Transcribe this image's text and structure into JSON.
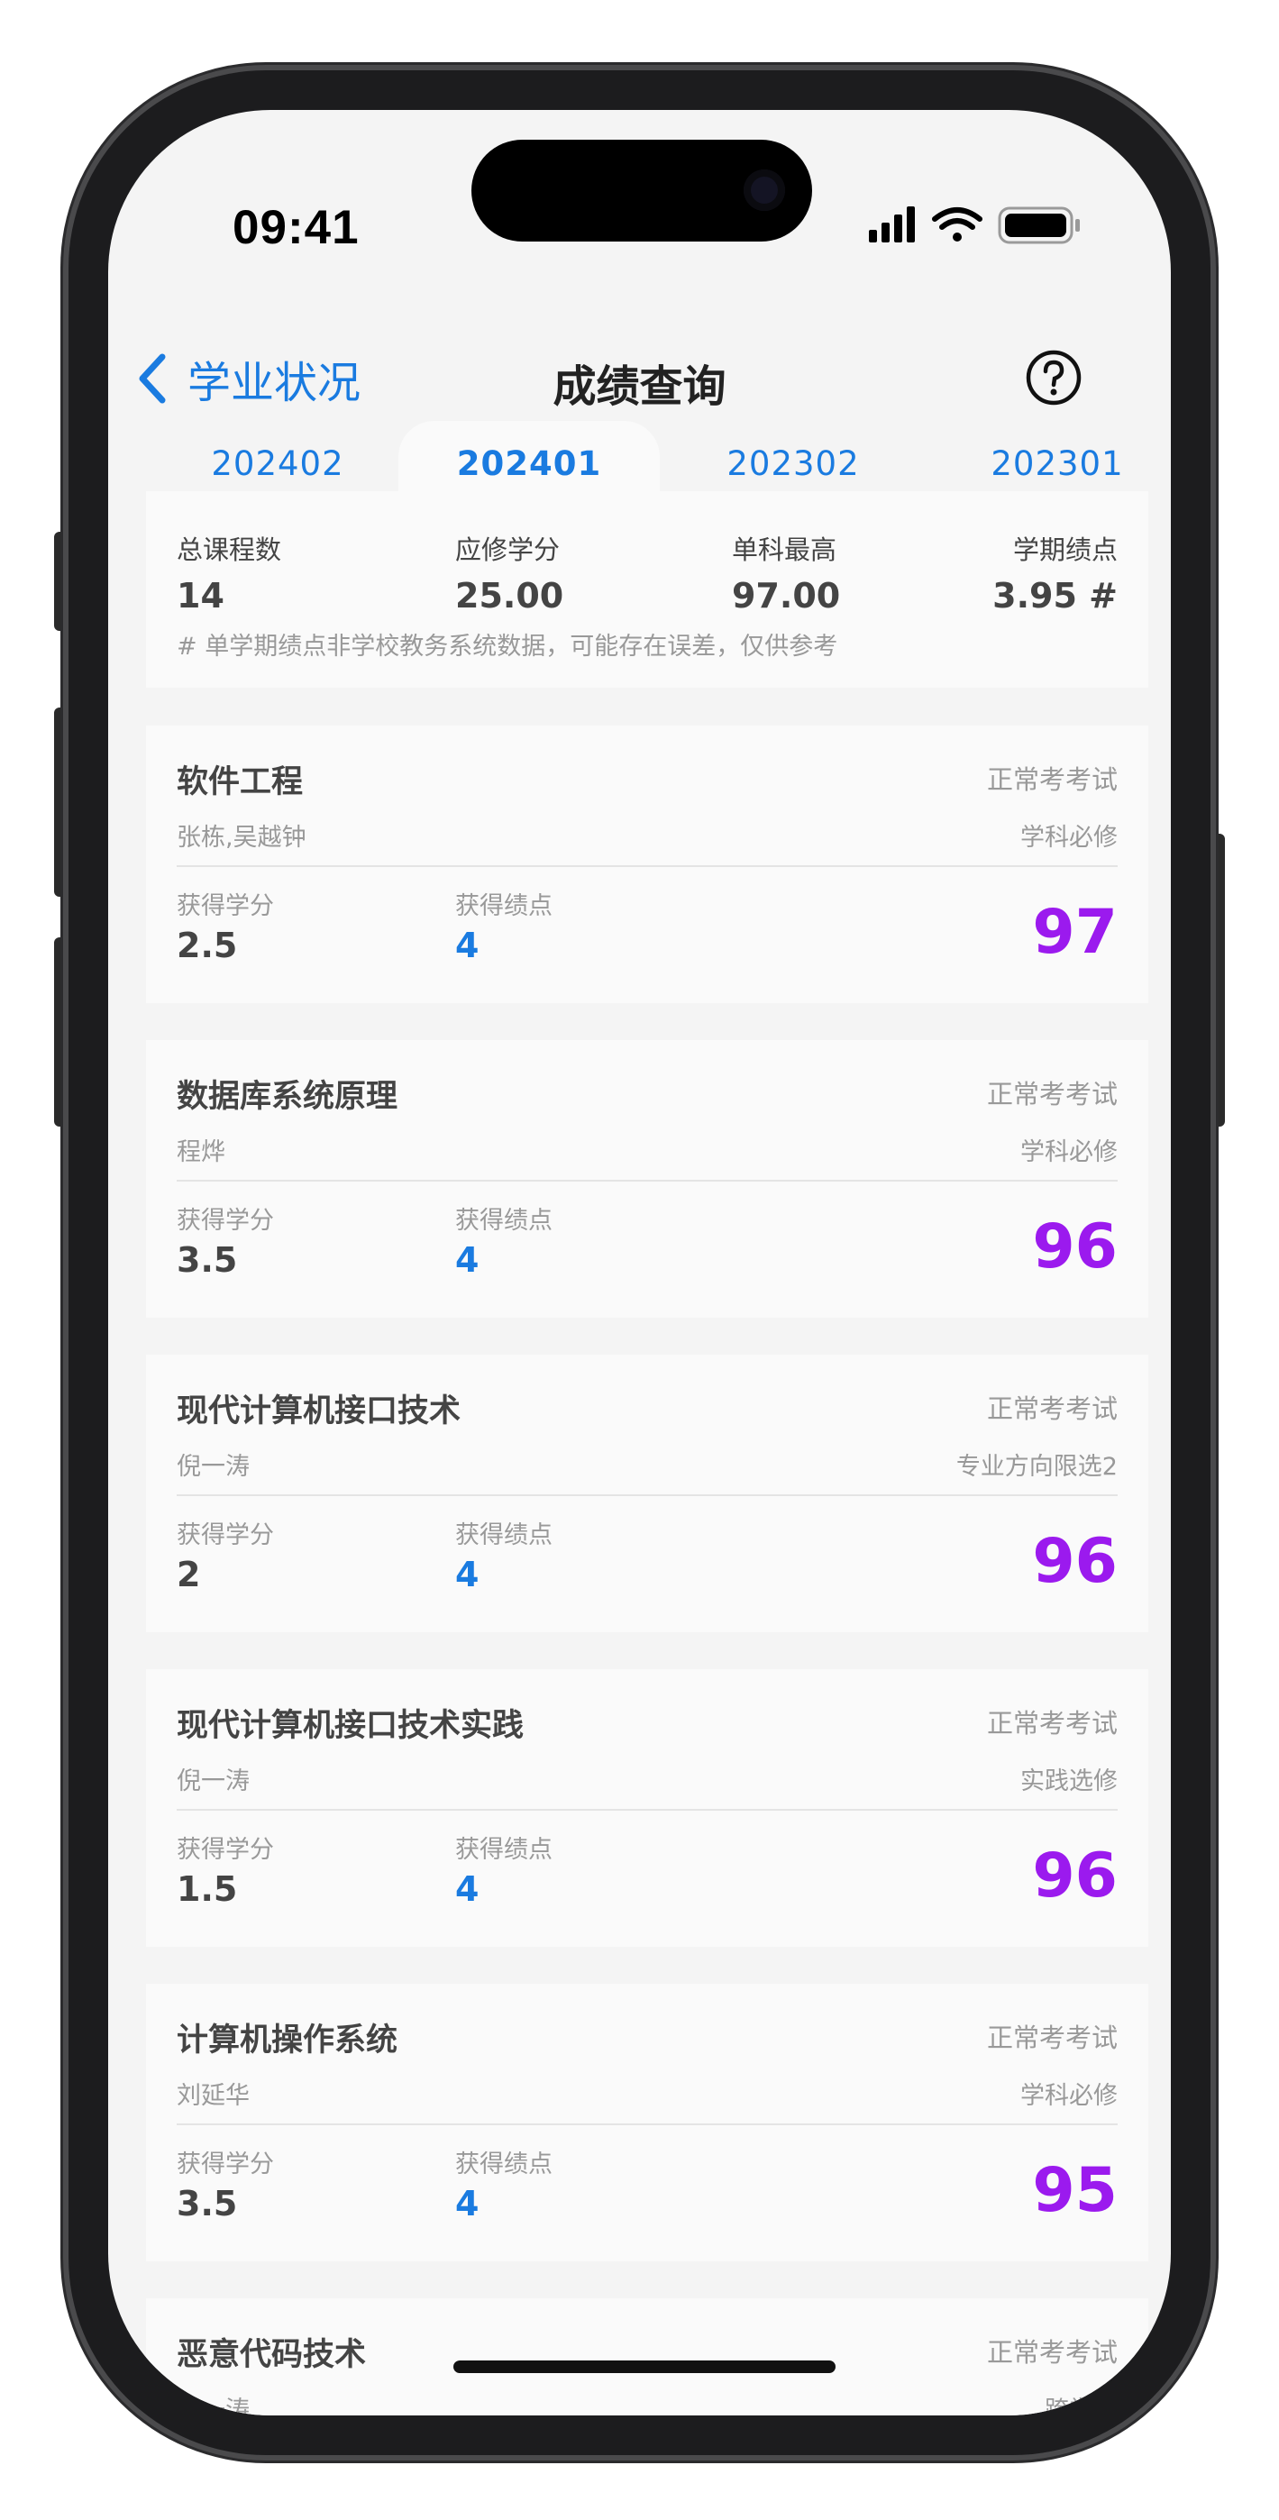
{
  "status_bar": {
    "time": "09:41"
  },
  "nav": {
    "back_label": "学业状况",
    "title": "成绩查询"
  },
  "tabs": [
    {
      "label": "202402",
      "active": false
    },
    {
      "label": "202401",
      "active": true
    },
    {
      "label": "202302",
      "active": false
    },
    {
      "label": "202301",
      "active": false
    }
  ],
  "summary": {
    "total_courses_label": "总课程数",
    "total_courses": "14",
    "required_credits_label": "应修学分",
    "required_credits": "25.00",
    "highest_label": "单科最高",
    "highest": "97.00",
    "term_gpa_label": "学期绩点",
    "term_gpa": "3.95 #",
    "note": "# 单学期绩点非学校教务系统数据，可能存在误差，仅供参考"
  },
  "labels": {
    "credits_earned": "获得学分",
    "gpa_earned": "获得绩点"
  },
  "courses": [
    {
      "name": "软件工程",
      "teacher": "张栋,吴越钟",
      "exam": "正常考考试",
      "type": "学科必修",
      "credits": "2.5",
      "gpa": "4",
      "score": "97"
    },
    {
      "name": "数据库系统原理",
      "teacher": "程烨",
      "exam": "正常考考试",
      "type": "学科必修",
      "credits": "3.5",
      "gpa": "4",
      "score": "96"
    },
    {
      "name": "现代计算机接口技术",
      "teacher": "倪一涛",
      "exam": "正常考考试",
      "type": "专业方向限选2",
      "credits": "2",
      "gpa": "4",
      "score": "96"
    },
    {
      "name": "现代计算机接口技术实践",
      "teacher": "倪一涛",
      "exam": "正常考考试",
      "type": "实践选修",
      "credits": "1.5",
      "gpa": "4",
      "score": "96"
    },
    {
      "name": "计算机操作系统",
      "teacher": "刘延华",
      "exam": "正常考考试",
      "type": "学科必修",
      "credits": "3.5",
      "gpa": "4",
      "score": "95"
    },
    {
      "name": "恶意代码技术",
      "teacher": "倪一涛",
      "exam": "正常考考试",
      "type": "跨学科",
      "credits": "",
      "gpa": "",
      "score": ""
    }
  ],
  "colors": {
    "accent_blue": "#1a7be0",
    "score_purple": "#9b1aee",
    "text_dark": "#444444",
    "text_muted": "#999999"
  },
  "icons": [
    "chevron-left-icon",
    "question-circle-icon",
    "cellular-signal-icon",
    "wifi-icon",
    "battery-icon"
  ]
}
